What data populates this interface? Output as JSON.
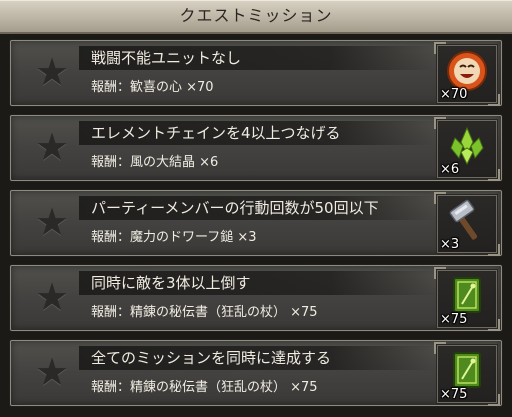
{
  "header": {
    "title": "クエストミッション"
  },
  "missions": [
    {
      "name": "戦闘不能ユニットなし",
      "reward": "報酬：歓喜の心 ×70",
      "qty": "×70",
      "icon": "smiling-face-orb-icon",
      "achieved": false
    },
    {
      "name": "エレメントチェインを4以上つなげる",
      "reward": "報酬：風の大結晶 ×6",
      "qty": "×6",
      "icon": "green-wind-crystal-icon",
      "achieved": false
    },
    {
      "name": "パーティーメンバーの行動回数が50回以下",
      "reward": "報酬：魔力のドワーフ鎚 ×3",
      "qty": "×3",
      "icon": "dwarf-hammer-icon",
      "achieved": false
    },
    {
      "name": "同時に敵を3体以上倒す",
      "reward": "報酬：精錬の秘伝書（狂乱の杖） ×75",
      "qty": "×75",
      "icon": "green-secret-book-icon",
      "achieved": false
    },
    {
      "name": "全てのミッションを同時に達成する",
      "reward": "報酬：精錬の秘伝書（狂乱の杖） ×75",
      "qty": "×75",
      "icon": "green-secret-book-icon",
      "achieved": false
    }
  ],
  "colors": {
    "panel": "#434240",
    "text": "#f0ece2",
    "header": "#bdb6a6"
  }
}
